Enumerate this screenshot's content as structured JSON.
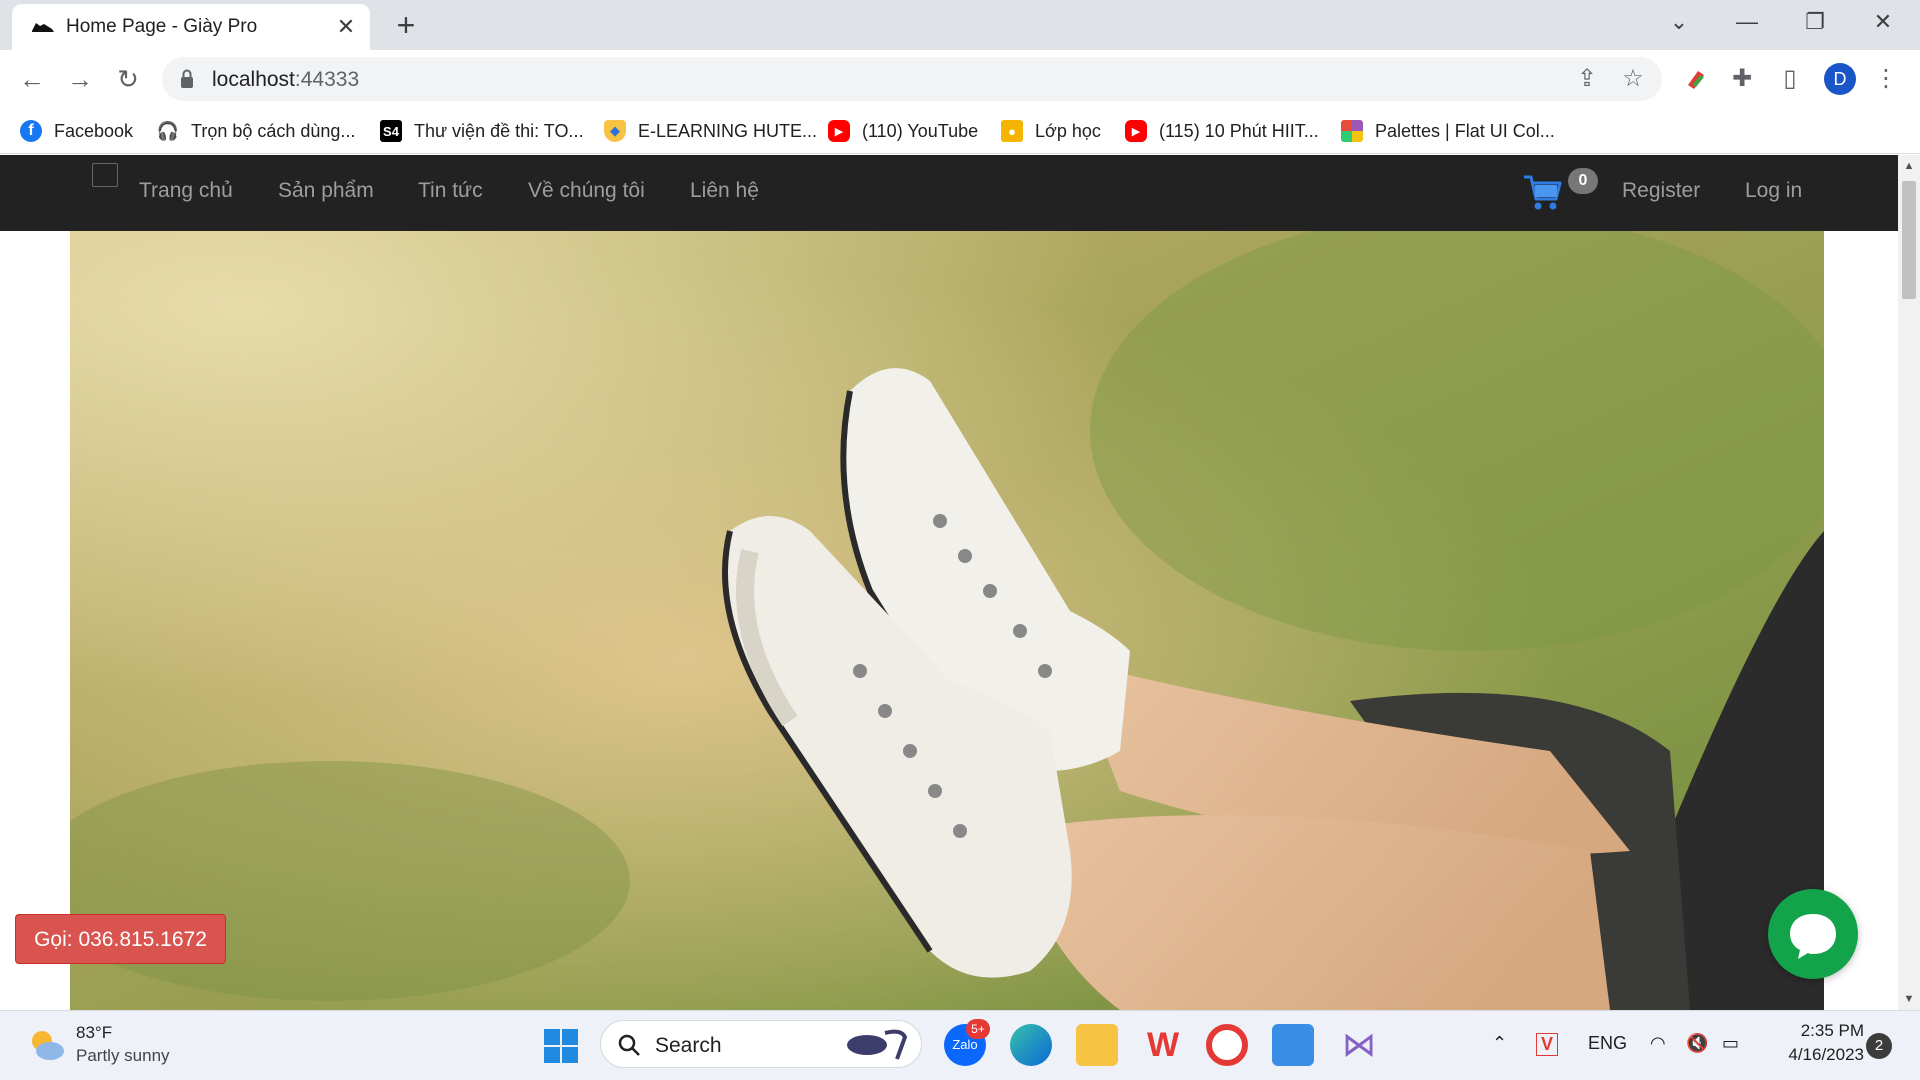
{
  "browser": {
    "tab_title": "Home Page - Giày Pro",
    "new_tab": "+",
    "url_host": "localhost",
    "url_port": ":44333",
    "profile_initial": "D"
  },
  "bookmarks": [
    {
      "label": "Facebook",
      "icon": "facebook-icon",
      "color": "#1877f2"
    },
    {
      "label": "Trọn bộ cách dùng...",
      "icon": "headphones-icon",
      "color": "#202124"
    },
    {
      "label": "Thư viện đề thi: TO...",
      "icon": "s4-icon",
      "color": "#000000"
    },
    {
      "label": "E-LEARNING HUTE...",
      "icon": "shield-icon",
      "color": "#2f6fdb"
    },
    {
      "label": "(110) YouTube",
      "icon": "youtube-icon",
      "color": "#ff0000"
    },
    {
      "label": "Lớp học",
      "icon": "classroom-icon",
      "color": "#f4b400"
    },
    {
      "label": "(115) 10 Phút HIIT...",
      "icon": "youtube-icon",
      "color": "#ff0000"
    },
    {
      "label": "Palettes | Flat UI Col...",
      "icon": "palette-icon",
      "color": "#e74c3c"
    }
  ],
  "site": {
    "nav": [
      "Trang chủ",
      "Sản phẩm",
      "Tin tức",
      "Về chúng tôi",
      "Liên hệ"
    ],
    "cart_count": "0",
    "register": "Register",
    "login": "Log in",
    "call_button": "Gọi: 036.815.1672",
    "navbar_color": "#222222",
    "call_color": "#d9534f",
    "chat_color": "#13a34a"
  },
  "taskbar": {
    "temperature": "83°F",
    "weather": "Partly sunny",
    "search": "Search",
    "zalo_badge": "5+",
    "language": "ENG",
    "time": "2:35 PM",
    "date": "4/16/2023",
    "notifications": "2"
  }
}
